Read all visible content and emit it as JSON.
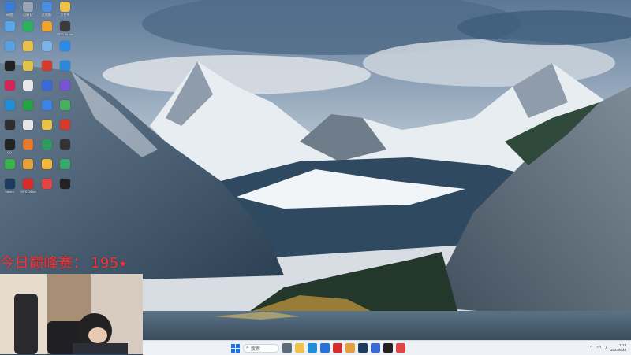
{
  "overlay": {
    "label": "今日巅峰赛：",
    "value": "195",
    "star": "⭑"
  },
  "desktop_icons": [
    {
      "label": "网络",
      "color": "#3d7bd9",
      "icon": "network-icon"
    },
    {
      "label": "回收站",
      "color": "#9aa6b8",
      "icon": "recycle-bin-icon"
    },
    {
      "label": "此电脑",
      "color": "#4c8fe0",
      "icon": "computer-icon"
    },
    {
      "label": "文件夹",
      "color": "#f1c24b",
      "icon": "folder-icon"
    },
    {
      "label": "",
      "color": "#59a7e8",
      "icon": "recycle-icon"
    },
    {
      "label": "",
      "color": "#2bb35b",
      "icon": "app-icon"
    },
    {
      "label": "",
      "color": "#f3a22f",
      "icon": "app-icon"
    },
    {
      "label": "OBS Studio",
      "color": "#3b3b3b",
      "icon": "obs-icon"
    },
    {
      "label": "",
      "color": "#5aa0e0",
      "icon": "app-icon"
    },
    {
      "label": "",
      "color": "#e7c14a",
      "icon": "folder-icon"
    },
    {
      "label": "",
      "color": "#7fb3e8",
      "icon": "app-icon"
    },
    {
      "label": "",
      "color": "#2d8ae6",
      "icon": "app-icon"
    },
    {
      "label": "",
      "color": "#222",
      "icon": "app-icon"
    },
    {
      "label": "",
      "color": "#e2c34a",
      "icon": "app-icon"
    },
    {
      "label": "",
      "color": "#d33b2c",
      "icon": "app-icon"
    },
    {
      "label": "",
      "color": "#2b88d8",
      "icon": "app-icon"
    },
    {
      "label": "",
      "color": "#d6245a",
      "icon": "app-icon"
    },
    {
      "label": "",
      "color": "#e8e8e8",
      "icon": "app-icon"
    },
    {
      "label": "",
      "color": "#3a6ad8",
      "icon": "app-icon"
    },
    {
      "label": "",
      "color": "#7a52d8",
      "icon": "app-icon"
    },
    {
      "label": "",
      "color": "#1f8fd8",
      "icon": "edge-icon"
    },
    {
      "label": "",
      "color": "#25a244",
      "icon": "app-icon"
    },
    {
      "label": "",
      "color": "#3c84e6",
      "icon": "app-icon"
    },
    {
      "label": "",
      "color": "#49b05f",
      "icon": "app-icon"
    },
    {
      "label": "",
      "color": "#2e2e2e",
      "icon": "app-icon"
    },
    {
      "label": "",
      "color": "#e6e6e6",
      "icon": "app-icon"
    },
    {
      "label": "",
      "color": "#e8c24a",
      "icon": "folder-icon"
    },
    {
      "label": "",
      "color": "#d53a2f",
      "icon": "app-icon"
    },
    {
      "label": "QQ",
      "color": "#222",
      "icon": "qq-icon"
    },
    {
      "label": "",
      "color": "#e87a2f",
      "icon": "app-icon"
    },
    {
      "label": "",
      "color": "#2f9a5e",
      "icon": "app-icon"
    },
    {
      "label": "",
      "color": "#333",
      "icon": "app-icon"
    },
    {
      "label": "",
      "color": "#3ab34a",
      "icon": "app-icon"
    },
    {
      "label": "",
      "color": "#e6a23a",
      "icon": "app-icon"
    },
    {
      "label": "",
      "color": "#f0b83c",
      "icon": "app-icon"
    },
    {
      "label": "",
      "color": "#3aa86a",
      "icon": "app-icon"
    },
    {
      "label": "Steam",
      "color": "#1c3b5e",
      "icon": "steam-icon"
    },
    {
      "label": "WPS Office",
      "color": "#d62c2c",
      "icon": "wps-icon"
    },
    {
      "label": "",
      "color": "#e24545",
      "icon": "app-icon"
    },
    {
      "label": "",
      "color": "#222",
      "icon": "app-icon"
    }
  ],
  "taskbar": {
    "search_placeholder": "搜索",
    "apps": [
      {
        "name": "task-view-icon",
        "color": "#5b6b7c"
      },
      {
        "name": "file-explorer-icon",
        "color": "#f0c24b"
      },
      {
        "name": "edge-icon",
        "color": "#1f8fd8"
      },
      {
        "name": "store-icon",
        "color": "#2a6fd6"
      },
      {
        "name": "wps-icon",
        "color": "#d62c2c"
      },
      {
        "name": "app-icon",
        "color": "#e2a13a"
      },
      {
        "name": "steam-icon",
        "color": "#1c3b5e"
      },
      {
        "name": "app-icon",
        "color": "#3a6ad8"
      },
      {
        "name": "app-icon",
        "color": "#222"
      },
      {
        "name": "app-icon",
        "color": "#e24545"
      }
    ],
    "time": "1:14",
    "date": "2024/6/24"
  }
}
